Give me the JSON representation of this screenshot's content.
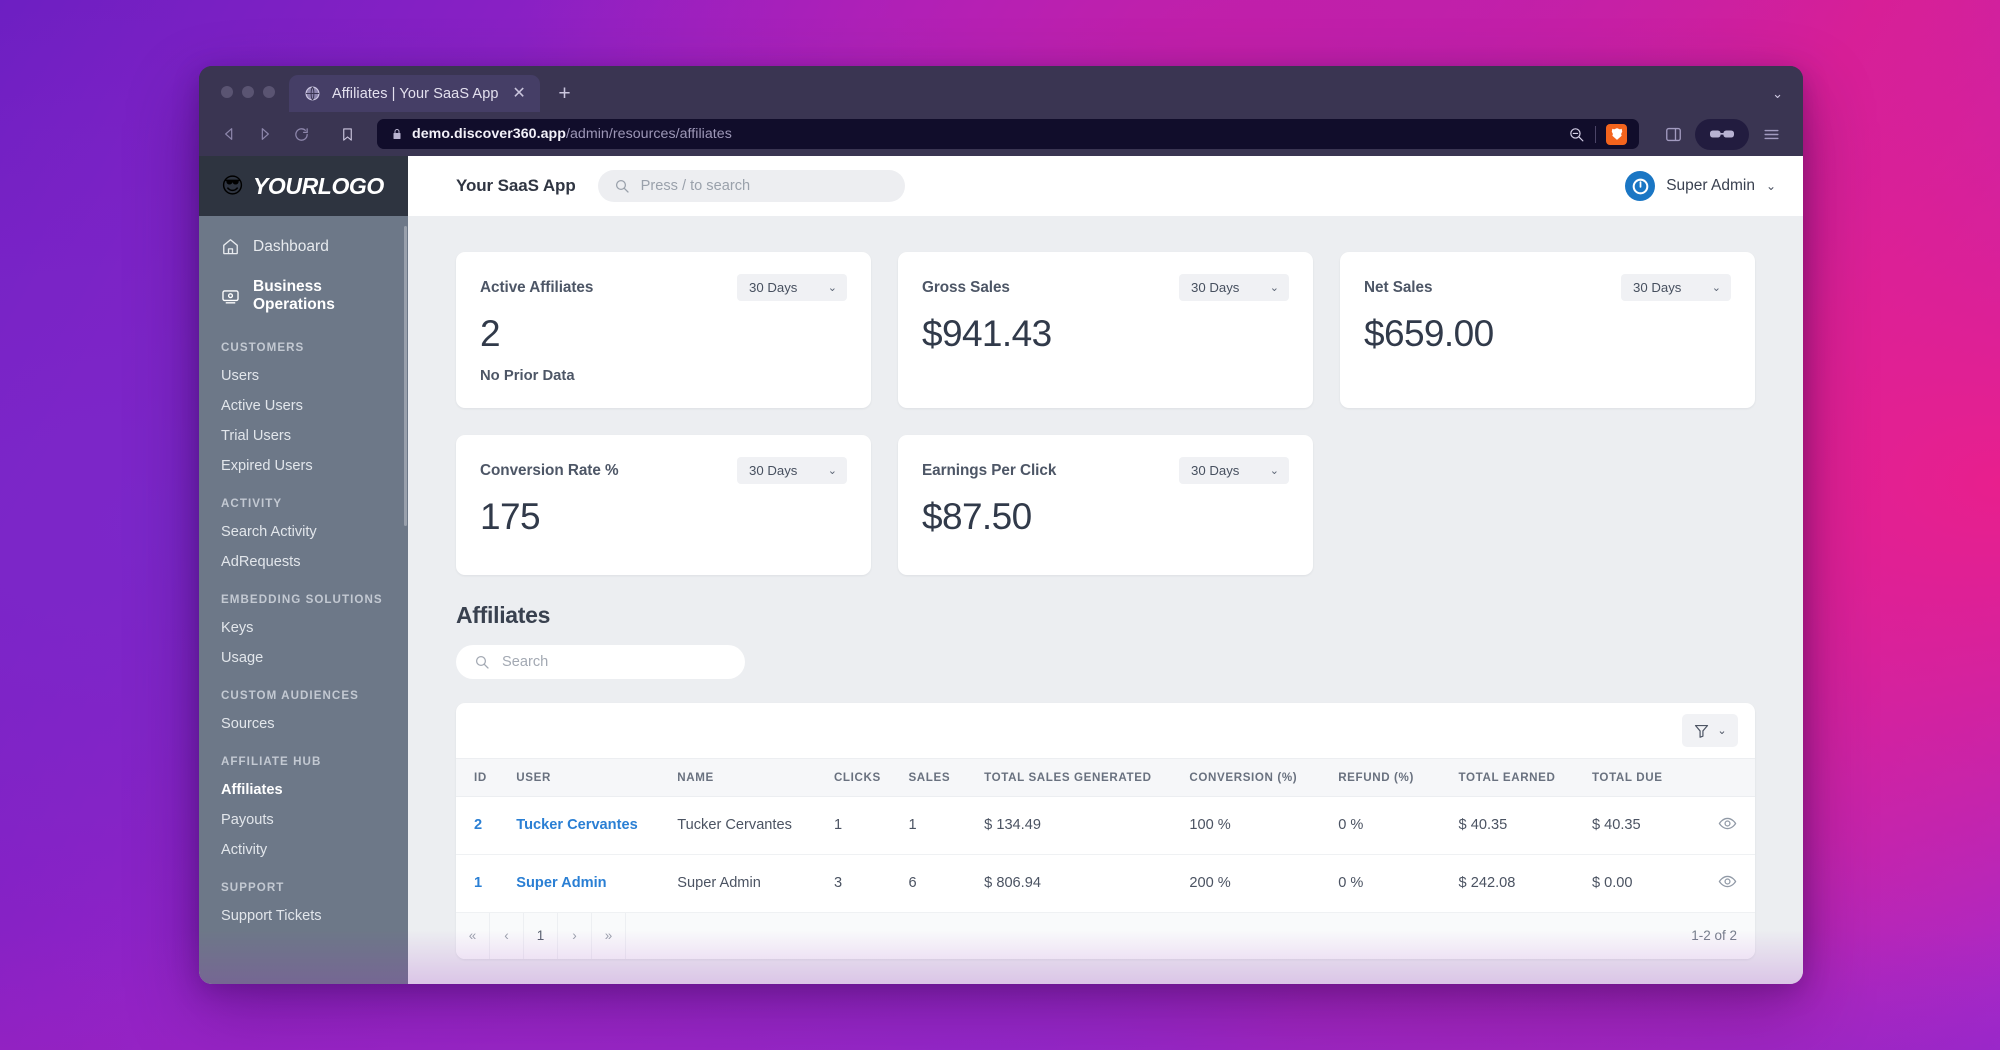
{
  "browser": {
    "tab": {
      "title": "Affiliates | Your SaaS App",
      "favicon_icon": "globe-icon",
      "close_icon": "close-icon"
    },
    "new_tab_label": "+",
    "tab_list_chevron": "⌄",
    "nav": {
      "back_icon": "back-arrow-icon",
      "forward_icon": "forward-arrow-icon",
      "reload_icon": "reload-icon",
      "bookmark_icon": "bookmark-icon"
    },
    "url": {
      "secure_icon": "lock-icon",
      "host": "demo.discover360.app",
      "path": "/admin/resources/affiliates"
    },
    "url_actions": {
      "zoom_out_icon": "zoom-out-icon",
      "shield_icon": "brave-shield-icon"
    },
    "right_actions": {
      "sidebar_icon": "sidebar-panel-icon",
      "glasses_icon": "glasses-icon",
      "menu_icon": "hamburger-menu-icon"
    }
  },
  "sidebar": {
    "logo": {
      "emoji": "😎",
      "text": "YOURLOGO"
    },
    "main_nav": [
      {
        "label": "Dashboard",
        "icon": "home-icon",
        "active": false
      },
      {
        "label": "Business Operations",
        "icon": "screen-icon",
        "active": true
      }
    ],
    "groups": [
      {
        "title": "CUSTOMERS",
        "items": [
          {
            "label": "Users",
            "current": false
          },
          {
            "label": "Active Users",
            "current": false
          },
          {
            "label": "Trial Users",
            "current": false
          },
          {
            "label": "Expired Users",
            "current": false
          }
        ]
      },
      {
        "title": "ACTIVITY",
        "items": [
          {
            "label": "Search Activity",
            "current": false
          },
          {
            "label": "AdRequests",
            "current": false
          }
        ]
      },
      {
        "title": "EMBEDDING SOLUTIONS",
        "items": [
          {
            "label": "Keys",
            "current": false
          },
          {
            "label": "Usage",
            "current": false
          }
        ]
      },
      {
        "title": "CUSTOM AUDIENCES",
        "items": [
          {
            "label": "Sources",
            "current": false
          }
        ]
      },
      {
        "title": "AFFILIATE HUB",
        "items": [
          {
            "label": "Affiliates",
            "current": true
          },
          {
            "label": "Payouts",
            "current": false
          },
          {
            "label": "Activity",
            "current": false
          }
        ]
      },
      {
        "title": "SUPPORT",
        "items": [
          {
            "label": "Support Tickets",
            "current": false
          }
        ]
      }
    ]
  },
  "appbar": {
    "title": "Your SaaS App",
    "search_placeholder": "Press / to search",
    "search_icon": "search-icon",
    "user": {
      "name": "Super Admin",
      "avatar_icon": "power-circle-icon",
      "caret": "⌄"
    }
  },
  "stats": [
    {
      "label": "Active Affiliates",
      "value": "2",
      "range": "30 Days",
      "subtext": "No Prior Data"
    },
    {
      "label": "Gross Sales",
      "value": "$941.43",
      "range": "30 Days",
      "subtext": ""
    },
    {
      "label": "Net Sales",
      "value": "$659.00",
      "range": "30 Days",
      "subtext": ""
    },
    {
      "label": "Conversion Rate %",
      "value": "175",
      "range": "30 Days",
      "subtext": ""
    },
    {
      "label": "Earnings Per Click",
      "value": "$87.50",
      "range": "30 Days",
      "subtext": ""
    }
  ],
  "affiliates": {
    "heading": "Affiliates",
    "search_placeholder": "Search",
    "search_icon": "search-icon",
    "filter": {
      "icon": "filter-funnel-icon",
      "caret": "⌄"
    },
    "columns": [
      "ID",
      "USER",
      "NAME",
      "CLICKS",
      "SALES",
      "TOTAL SALES GENERATED",
      "CONVERSION (%)",
      "REFUND (%)",
      "TOTAL EARNED",
      "TOTAL DUE"
    ],
    "rows": [
      {
        "id": "2",
        "user": "Tucker Cervantes",
        "name": "Tucker Cervantes",
        "clicks": "1",
        "sales": "1",
        "total_sales_generated": "$ 134.49",
        "conversion": "100 %",
        "refund": "0 %",
        "total_earned": "$ 40.35",
        "total_due": "$ 40.35",
        "view_icon": "eye-icon"
      },
      {
        "id": "1",
        "user": "Super Admin",
        "name": "Super Admin",
        "clicks": "3",
        "sales": "6",
        "total_sales_generated": "$ 806.94",
        "conversion": "200 %",
        "refund": "0 %",
        "total_earned": "$ 242.08",
        "total_due": "$ 0.00",
        "view_icon": "eye-icon"
      }
    ],
    "pagination": {
      "first": "«",
      "prev": "‹",
      "page": "1",
      "next": "›",
      "last": "»",
      "count": "1-2 of 2"
    }
  },
  "colors": {
    "link": "#2a7fd4",
    "sidebar_bg": "#6d7888",
    "logo_bg": "#2e3440",
    "browser_chrome": "#3a3552",
    "urlbar_bg": "#110d2b",
    "avatar_blue": "#1a76c4",
    "brave_orange": "#f4641d",
    "page_bg": "#eceef1"
  }
}
